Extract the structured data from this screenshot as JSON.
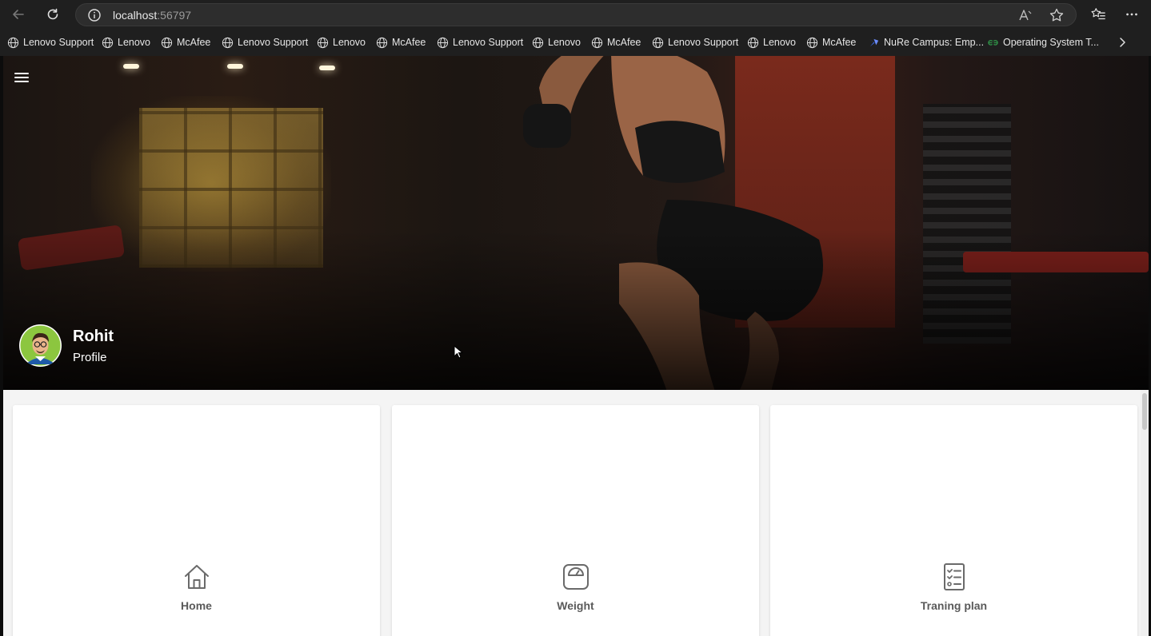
{
  "browser": {
    "url_host": "localhost",
    "url_port": ":56797",
    "bookmarks": [
      {
        "label": "Lenovo Support",
        "icon": "globe-icon"
      },
      {
        "label": "Lenovo",
        "icon": "globe-icon"
      },
      {
        "label": "McAfee",
        "icon": "globe-icon"
      },
      {
        "label": "Lenovo Support",
        "icon": "globe-icon"
      },
      {
        "label": "Lenovo",
        "icon": "globe-icon"
      },
      {
        "label": "McAfee",
        "icon": "globe-icon"
      },
      {
        "label": "Lenovo Support",
        "icon": "globe-icon"
      },
      {
        "label": "Lenovo",
        "icon": "globe-icon"
      },
      {
        "label": "McAfee",
        "icon": "globe-icon"
      },
      {
        "label": "Lenovo Support",
        "icon": "globe-icon"
      },
      {
        "label": "Lenovo",
        "icon": "globe-icon"
      },
      {
        "label": "McAfee",
        "icon": "globe-icon"
      },
      {
        "label": "NuRe Campus: Emp...",
        "icon": "nure-campus-icon"
      },
      {
        "label": "Operating System T...",
        "icon": "geeksforgeeks-icon"
      }
    ]
  },
  "profile": {
    "name": "Rohit",
    "subtitle": "Profile"
  },
  "cards": [
    {
      "label": "Home",
      "icon": "home-icon"
    },
    {
      "label": "Weight",
      "icon": "weight-scale-icon"
    },
    {
      "label": "Traning plan",
      "icon": "checklist-icon"
    }
  ],
  "colors": {
    "chrome_bg": "#1f1f1f",
    "address_bg": "#2d2d2d",
    "page_bg": "#f4f4f4",
    "card_bg": "#ffffff",
    "card_label": "#5a5a5a",
    "avatar_ring": "#7bb32e"
  }
}
